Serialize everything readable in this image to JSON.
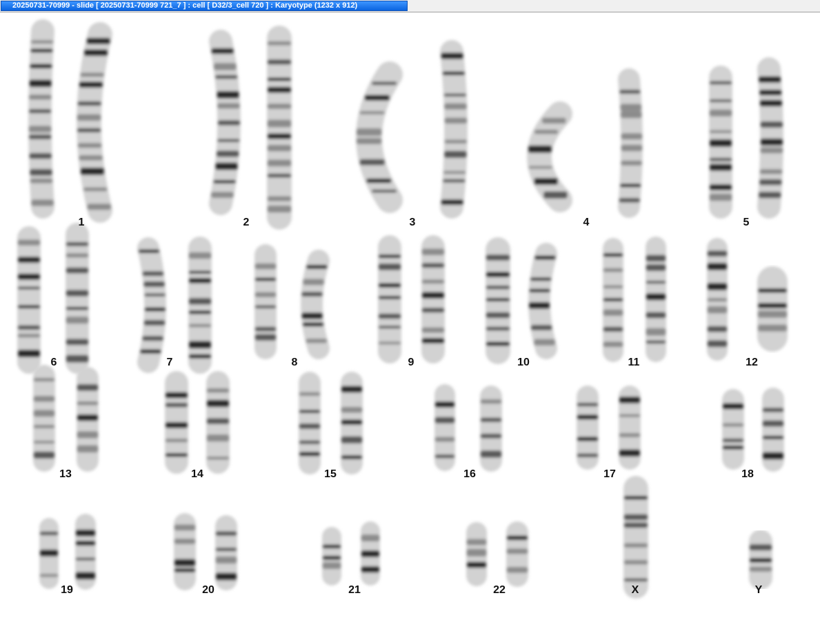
{
  "window": {
    "title": "20250731-70999 - slide [ 20250731-70999 721_7 ] : cell [ D32/3_cell 720 ] : Karyotype  (1232 x 912)"
  },
  "colors": {
    "title_bar": "#0a64e0",
    "chromosome_dark": "#1a1a1a",
    "chromosome_light": "#d8d8d8",
    "background": "#ffffff"
  },
  "karyotype": {
    "labels": [
      "1",
      "2",
      "3",
      "4",
      "5",
      "6",
      "7",
      "8",
      "9",
      "10",
      "11",
      "12",
      "13",
      "14",
      "15",
      "16",
      "17",
      "18",
      "19",
      "20",
      "21",
      "22",
      "X",
      "Y"
    ]
  }
}
